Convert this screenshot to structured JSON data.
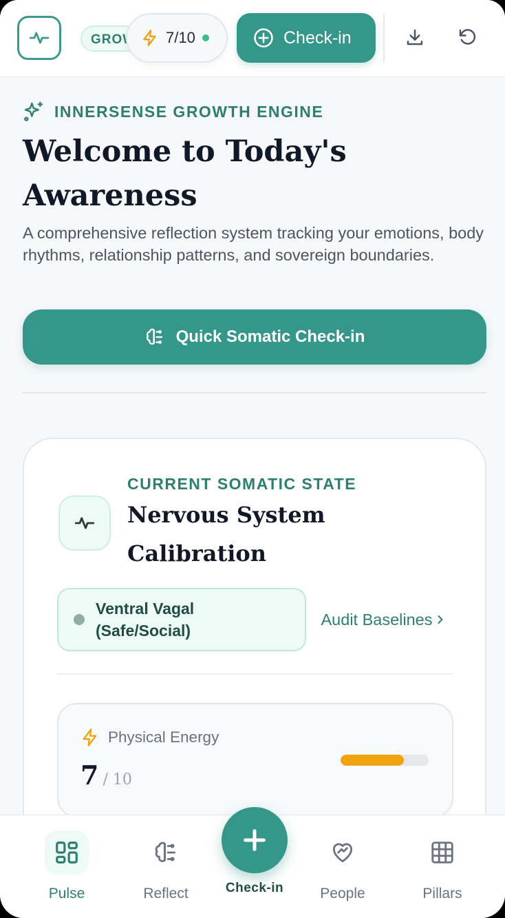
{
  "header": {
    "grow_label": "GROWTH",
    "energy_value": "7/10",
    "checkin_label": "Check-in",
    "icons": [
      "pulse-icon",
      "lightning-icon",
      "plus-circle-icon",
      "download-icon",
      "refresh-icon"
    ]
  },
  "hero": {
    "eyebrow": "INNERSENSE GROWTH ENGINE",
    "title": "Welcome to Today's Awareness",
    "description": "A comprehensive reflection system tracking your emotions, body rhythms, relationship patterns, and sovereign boundaries.",
    "quick_button": "Quick Somatic Check-in"
  },
  "somatic_card": {
    "eyebrow": "CURRENT SOMATIC STATE",
    "title": "Nervous System Calibration",
    "state": "Ventral Vagal (Safe/Social)",
    "audit_link": "Audit Baselines",
    "energy": {
      "label": "Physical Energy",
      "value": "7",
      "max": "/ 10",
      "fraction": 0.72
    }
  },
  "nav": {
    "items": [
      {
        "label": "Pulse",
        "icon": "grid-icon",
        "active": true
      },
      {
        "label": "Reflect",
        "icon": "brain-icon"
      },
      {
        "label": "Check-in",
        "icon": "plus-icon"
      },
      {
        "label": "People",
        "icon": "heart-handshake-icon"
      },
      {
        "label": "Pillars",
        "icon": "table-icon"
      }
    ]
  },
  "colors": {
    "accent": "#35968a",
    "accent_text": "#2c7f71",
    "energy": "#f0a20f",
    "status_dot": "#3cbf85"
  }
}
